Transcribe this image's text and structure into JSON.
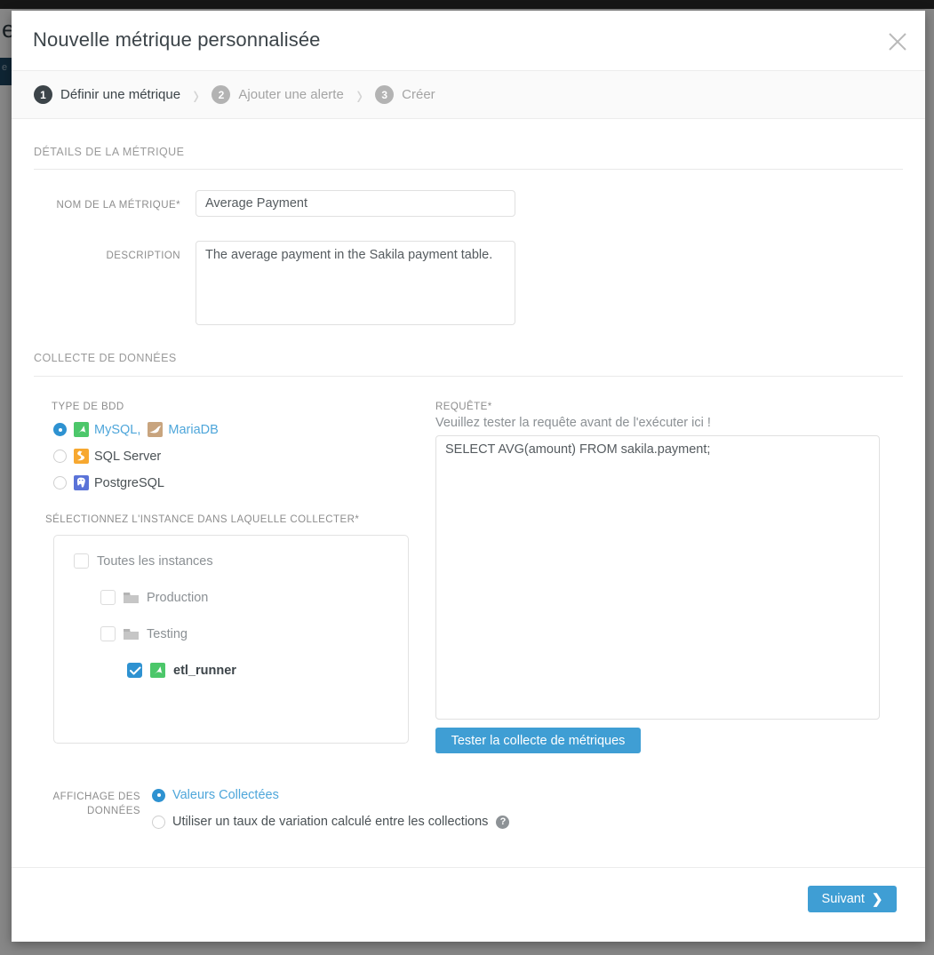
{
  "background": {
    "letter": "e",
    "side_tab_label": "e"
  },
  "modal": {
    "title": "Nouvelle métrique personnalisée",
    "close_icon": "close-icon"
  },
  "steps": [
    {
      "num": "1",
      "label": "Définir une métrique",
      "state": "active"
    },
    {
      "num": "2",
      "label": "Ajouter une alerte",
      "state": "inactive"
    },
    {
      "num": "3",
      "label": "Créer",
      "state": "inactive"
    }
  ],
  "step_separator": "›",
  "sections": {
    "metric_details_title": "DÉTAILS DE LA MÉTRIQUE",
    "data_collection_title": "COLLECTE DE DONNÉES"
  },
  "fields": {
    "metric_name_label": "NOM DE LA MÉTRIQUE*",
    "metric_name_value": "Average Payment",
    "metric_name_placeholder": "",
    "description_label": "DESCRIPTION",
    "description_value": "The average payment in the Sakila payment table.",
    "description_placeholder": ""
  },
  "db_type": {
    "label": "TYPE DE BDD",
    "options": [
      {
        "id": "mysql-mariadb",
        "parts": [
          "MySQL,",
          "MariaDB"
        ],
        "icons": [
          "mysql-icon",
          "mariadb-icon"
        ],
        "selected": true
      },
      {
        "id": "sqlserver",
        "parts": [
          "SQL Server"
        ],
        "icons": [
          "sqlserver-icon"
        ],
        "selected": false
      },
      {
        "id": "postgresql",
        "parts": [
          "PostgreSQL"
        ],
        "icons": [
          "postgresql-icon"
        ],
        "selected": false
      }
    ],
    "mysql_label": "MySQL,",
    "mariadb_label": "MariaDB",
    "sqlserver_label": "SQL Server",
    "postgresql_label": "PostgreSQL"
  },
  "instances": {
    "label": "SÉLECTIONNEZ L'INSTANCE DANS LAQUELLE COLLECTER*",
    "rows": [
      {
        "label": "Toutes les instances",
        "checked": false,
        "level": 0,
        "icon": null
      },
      {
        "label": "Production",
        "checked": false,
        "level": 1,
        "icon": "folder-icon"
      },
      {
        "label": "Testing",
        "checked": false,
        "level": 1,
        "icon": "folder-icon"
      },
      {
        "label": "etl_runner",
        "checked": true,
        "level": 2,
        "icon": "mysql-icon"
      }
    ],
    "all_label": "Toutes les instances",
    "production_label": "Production",
    "testing_label": "Testing",
    "etl_runner_label": "etl_runner"
  },
  "query": {
    "label": "REQUÊTE*",
    "hint": "Veuillez tester la requête avant de l'exécuter ici !",
    "value": "SELECT AVG(amount) FROM sakila.payment;",
    "placeholder": "",
    "test_button": "Tester la collecte de métriques"
  },
  "data_display": {
    "label_line1": "AFFICHAGE DES",
    "label_line2": "DONNÉES",
    "options": [
      {
        "label": "Valeurs Collectées",
        "selected": true
      },
      {
        "label": "Utiliser un taux de variation calculé entre les collections",
        "selected": false
      }
    ],
    "collected_values_label": "Valeurs Collectées",
    "rate_of_change_label": "Utiliser un taux de variation calculé entre les collections",
    "help_icon": "help-icon",
    "help_glyph": "?"
  },
  "footer": {
    "next_label": "Suivant",
    "next_chevron": "❯"
  },
  "colors": {
    "accent": "#3f9ed4",
    "link": "#4ea6da",
    "checkbox_checked": "#2e92d1",
    "step_active": "#3c4449",
    "step_inactive": "#b3b3b3"
  }
}
